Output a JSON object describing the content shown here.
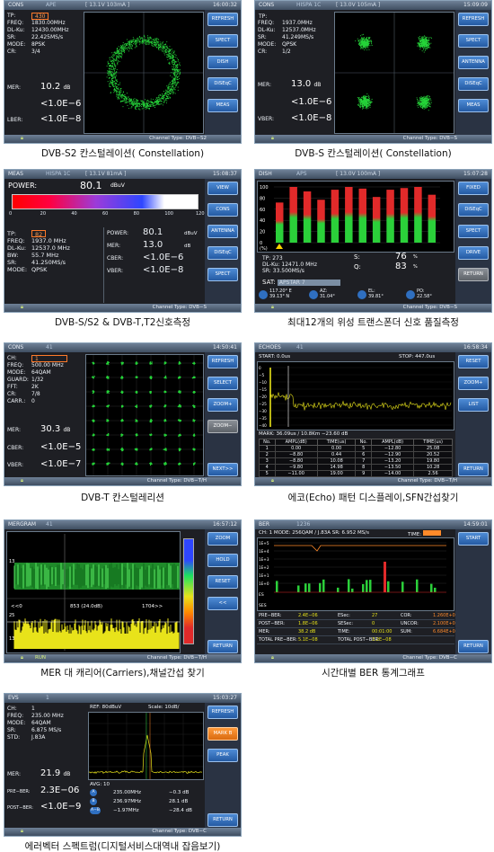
{
  "panels": {
    "p1": {
      "title": "CONS",
      "mode": "APE",
      "status": "[ 13.1V 103mA ]",
      "time": "16:00:32",
      "tp": "430",
      "info": [
        [
          "FREQ:",
          "1830.00MHz"
        ],
        [
          "DL-Ku:",
          "12430.00MHz"
        ],
        [
          "SR:",
          "22.425MS/s"
        ],
        [
          "MODE:",
          "8PSK"
        ],
        [
          "CR:",
          "3/4"
        ]
      ],
      "mer_k": "MER:",
      "mer_v": "10.2",
      "mer_u": "dB",
      "cber_v": "<1.0E−6",
      "lber_k": "LBER:",
      "lber_v": "<1.0E−8",
      "buttons": [
        "REFRESH",
        "SPECT",
        "DISH",
        "DiSEqC",
        "MEAS"
      ],
      "channel": "Channel Type: DVB−S2",
      "caption": "DVB-S2 칸스털레이션( Constellation)"
    },
    "p2": {
      "title": "CONS",
      "mode": "HISPA 1C",
      "status": "[ 13.0V 105mA ]",
      "time": "15:09:09",
      "tp": "TP:",
      "info": [
        [
          "FREQ:",
          "1937.0MHz"
        ],
        [
          "DL-Ku:",
          "12537.0MHz"
        ],
        [
          "SR:",
          "41.249MS/s"
        ],
        [
          "MODE:",
          "QPSK"
        ],
        [
          "CR:",
          "1/2"
        ]
      ],
      "mer_k": "MER:",
      "mer_v": "13.0",
      "mer_u": "dB",
      "cber_v": "<1.0E−6",
      "vber_k": "VBER:",
      "vber_v": "<1.0E−8",
      "buttons": [
        "REFRESH",
        "SPECT",
        "ANTENNA",
        "DiSEqC",
        "MEAS"
      ],
      "channel": "Channel Type: DVB−S",
      "caption": "DVB-S 칸스털레이션( Constellation)"
    },
    "p3": {
      "title": "MEAS",
      "mode": "HISPA 1C",
      "status": "[ 13.1V 81mA ]",
      "time": "15:08:37",
      "power_k": "POWER:",
      "power_v": "80.1",
      "power_u": "dBuV",
      "scale": [
        "0",
        "20",
        "40",
        "60",
        "80",
        "100",
        "120"
      ],
      "tp": "82",
      "info": [
        [
          "FREQ:",
          "1937.0 MHz"
        ],
        [
          "DL-Ku:",
          "12537.0 MHz"
        ],
        [
          "BW:",
          "55.7 MHz"
        ],
        [
          "SR:",
          "41.250MS/s"
        ],
        [
          "MODE:",
          "QPSK"
        ]
      ],
      "right": [
        [
          "POWER:",
          "80.1",
          "dBuV"
        ],
        [
          "MER:",
          "13.0",
          "dB"
        ],
        [
          "CBER:",
          "<1.0E−6",
          ""
        ],
        [
          "VBER:",
          "<1.0E−8",
          ""
        ]
      ],
      "buttons": [
        "VIEW",
        "CONS",
        "ANTENNA",
        "DiSEqC",
        "SPECT"
      ],
      "channel": "Channel Type: DVB−S",
      "caption": "DVB-S/S2 & DVB-T,T2신호측정"
    },
    "p4": {
      "title": "DISH",
      "mode": "APS",
      "status": "[ 13.0V 100mA ]",
      "time": "15:07:28",
      "yticks": [
        "100",
        "80",
        "60",
        "40",
        "20",
        "0"
      ],
      "ylabel": "(%)",
      "bars": [
        72,
        100,
        92,
        77,
        95,
        100,
        97,
        82,
        95,
        98,
        100,
        86
      ],
      "tp": "273",
      "info": [
        [
          "DL-Ku:",
          "12471.0 MHz"
        ],
        [
          "SR:",
          "33.500MS/s"
        ]
      ],
      "s_k": "S:",
      "s_v": "76",
      "q_k": "Q:",
      "q_v": "83",
      "pct": "%",
      "sat_k": "SAT:",
      "sat_v": "APSTAR 7",
      "bottom": [
        [
          "117.20° E",
          "39.13° N"
        ],
        [
          "AZ:",
          "31.04°"
        ],
        [
          "EL:",
          "39.81°"
        ],
        [
          "PO:",
          "22.58°"
        ]
      ],
      "buttons": [
        "FIXED",
        "DiSEqC",
        "SPECT",
        "DRIVE",
        "RETURN"
      ],
      "channel": "Channel Type: DVB−S",
      "caption": "최대12개의 위성 트랜스폰더 신호 품질측정"
    },
    "p5": {
      "title": "CONS",
      "mode": "41",
      "time": "14:50:41",
      "info": [
        [
          "CH:",
          "1"
        ],
        [
          "FREQ:",
          "500.00 MHz"
        ],
        [
          "MODE:",
          "64QAM"
        ],
        [
          "GUARD:",
          "1/32"
        ],
        [
          "FFT:",
          "2K"
        ],
        [
          "CR:",
          "7/8"
        ],
        [
          "CARR.:",
          "0"
        ]
      ],
      "mer_k": "MER:",
      "mer_v": "30.3",
      "mer_u": "dB",
      "cber_k": "CBER:",
      "cber_v": "<1.0E−5",
      "vber_k": "VBER:",
      "vber_v": "<1.0E−7",
      "buttons": [
        "REFRESH",
        "SELECT",
        "ZOOM+",
        "ZOOM−",
        "NEXT>>"
      ],
      "channel": "Channel Type: DVB−T/H",
      "caption": "DVB-T 칸스털레리션"
    },
    "p6": {
      "title": "ECHOES",
      "mode": "41",
      "time": "16:58:34",
      "start_k": "START:",
      "start_v": "0.0us",
      "stop_k": "STOP:",
      "stop_v": "447.0us",
      "ylabel": "dB",
      "yt": [
        "0",
        "−5",
        "−10",
        "−15",
        "−20",
        "−25",
        "−30",
        "−35",
        "−40"
      ],
      "mark": "MARK:  36.09us / 10.8Km    −23.60 dB",
      "thead": [
        "No.",
        "AMPL(dB)",
        "TIME(us)",
        "No.",
        "AMPL(dB)",
        "TIME(us)"
      ],
      "rows": [
        [
          "1",
          "0.00",
          "0.00",
          "5",
          "−12.80",
          "25.08"
        ],
        [
          "2",
          "−8.80",
          "0.44",
          "6",
          "−12.90",
          "20.52"
        ],
        [
          "3",
          "−8.80",
          "10.08",
          "7",
          "−13.20",
          "19.80"
        ],
        [
          "4",
          "−9.80",
          "14.98",
          "8",
          "−13.50",
          "10.28"
        ],
        [
          "5",
          "−11.00",
          "19.00",
          "9",
          "−14.00",
          "2.56"
        ]
      ],
      "buttons": [
        "RESET",
        "ZOOM+",
        "LIST",
        "RETURN"
      ],
      "channel": "Channel Type: DVB−T/H",
      "caption": "에코(Echo) 패턴 디스플레이,SFN간섭찾기"
    },
    "p7": {
      "title": "MERGRAM",
      "mode": "41",
      "time": "16:57:12",
      "left": "<<0",
      "mid": "853 (24.0dB)",
      "right": "1704>>",
      "y1": "13",
      "y2": "25",
      "y3": "13",
      "status": "RUN",
      "buttons": [
        "ZOOM",
        "HOLD",
        "RESET",
        "<<",
        "RETURN"
      ],
      "channel": "Channel Type: DVB−T/H",
      "caption": "MER 대 캐리어(Carriers),채널간섭 찾기"
    },
    "p8": {
      "title": "BER",
      "mode": "1236",
      "time": "14:59:01",
      "hdr": "CH: 1 MODE: 256QAM / J.83A  SR: 6.952 MS/s",
      "time_k": "TIME:",
      "yt": [
        "1E+5",
        "1E+4",
        "1E+3",
        "1E+2",
        "1E+1",
        "1E+0"
      ],
      "ses": "SES",
      "es": "ES",
      "stats": [
        [
          "PRE−BER:",
          "2.4E−06",
          "ESec:",
          "27",
          "COR:",
          "1.260E+02"
        ],
        [
          "POST−BER:",
          "1.8E−06",
          "SESec:",
          "0",
          "UNCOR:",
          "2.100E+02"
        ],
        [
          "MER:",
          "38.2 dB",
          "TIME:",
          "00:01:00",
          "SUM:",
          "6.684E+09"
        ],
        [
          "TOTAL PRE−BER:",
          "5.1E−08",
          "TOTAL POST−BER:",
          "3.2E−08",
          "",
          ""
        ]
      ],
      "buttons": [
        "START",
        "RETURN"
      ],
      "channel": "Channel Type: DVB−C",
      "caption": "시간대별 BER 통계그래프"
    },
    "p9": {
      "title": "EVS",
      "mode": "1",
      "time": "15:03:27",
      "info": [
        [
          "CH:",
          "1"
        ],
        [
          "FREQ:",
          "235.00 MHz"
        ],
        [
          "MODE:",
          "64QAM"
        ],
        [
          "SR:",
          "6.875 MS/s"
        ],
        [
          "STD:",
          "J.83A"
        ]
      ],
      "ref": "REF:   80dBuV",
      "scale": "Scale:   10dB/",
      "mer_k": "MER:",
      "mer_v": "21.9",
      "mer_u": "dB",
      "pre_k": "PRE−BER:",
      "pre_v": "2.3E−06",
      "post_k": "POST−BER:",
      "post_v": "<1.0E−9",
      "avg": "AVG:     10",
      "markers": [
        [
          "A",
          "235.00MHz",
          "−0.3 dB"
        ],
        [
          "B",
          "236.97MHz",
          "28.1 dB"
        ],
        [
          "A−B",
          "−1.97MHz",
          "−28.4 dB"
        ]
      ],
      "buttons": [
        "REFRESH",
        "MARK B",
        "PEAK",
        "RETURN"
      ],
      "channel": "Channel Type: DVB−C",
      "caption": "에러벡터 스펙트럼(디지털서비스대역내 잡음보기)"
    }
  },
  "colors": {
    "accent": "#2f6fc0",
    "bar_green": "#2bd03a",
    "bar_red": "#e12a2a",
    "trace_yellow": "#e8e31a"
  }
}
